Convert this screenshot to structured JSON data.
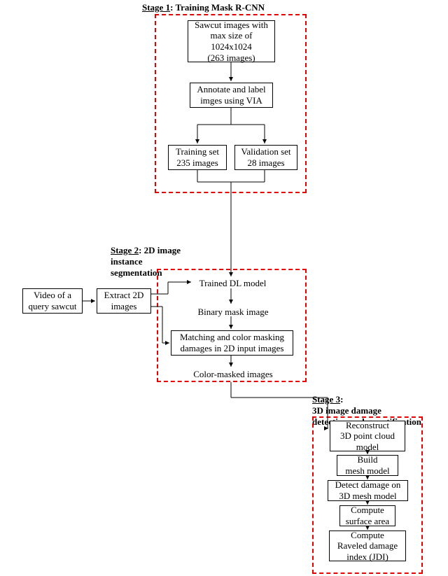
{
  "stages": {
    "s1": {
      "prefix": "Stage 1",
      "rest": ": Training Mask R-CNN"
    },
    "s2": {
      "prefix": "Stage 2",
      "rest": ": 2D image\ninstance\nsegmentation"
    },
    "s3": {
      "prefix": "Stage 3",
      "rest": ":\n3D image damage\ndetection and quantification"
    }
  },
  "boxes": {
    "sawcut": "Sawcut images with\nmax size of\n1024x1024\n(263 images)",
    "annotate": "Annotate and label\nimges using VIA",
    "train_set": "Training set\n235 images",
    "valid_set": "Validation set\n28 images",
    "video": "Video of a\nquery sawcut",
    "extract": "Extract 2D\nimages",
    "trained_model": "Trained DL model",
    "binary_mask": "Binary mask image",
    "matching": "Matching and color masking\ndamages in 2D input images",
    "color_masked": "Color-masked images",
    "reconstruct": "Reconstruct\n3D point cloud\nmodel",
    "mesh": "Build\nmesh model",
    "detect3d": "Detect damage on\n3D mesh model",
    "surface": "Compute\nsurface area",
    "jdi": "Compute\nRaveled damage\nindex (JDI)"
  }
}
